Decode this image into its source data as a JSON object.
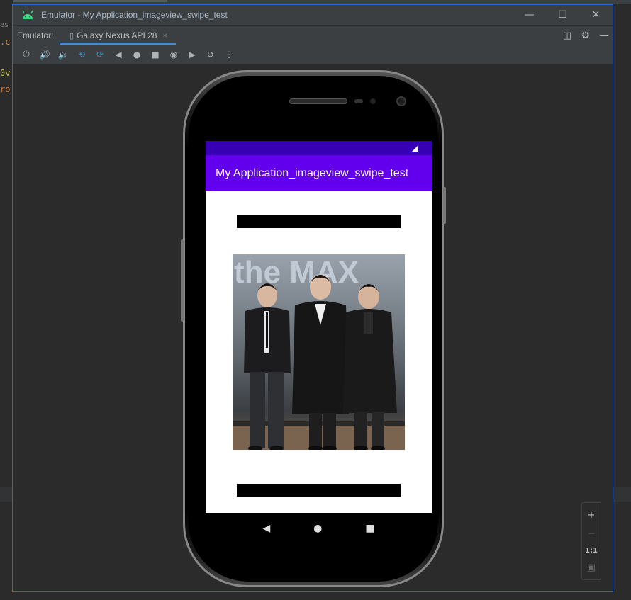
{
  "window": {
    "title": "Emulator - My Application_imageview_swipe_test"
  },
  "tabbar": {
    "label": "Emulator:",
    "device_tab": "Galaxy Nexus API 28",
    "close": "×"
  },
  "ide_fragments": {
    "line1": "es",
    "line2": ".c",
    "line3": "0v",
    "line4": "ro"
  },
  "app": {
    "title": "My Application_imageview_swipe_test"
  },
  "photo": {
    "caption_text": "the MAX"
  },
  "zoom": {
    "zoom_in": "+",
    "zoom_out": "−",
    "actual_size": "1:1"
  },
  "colors": {
    "status_bar": "#3700b3",
    "app_bar": "#6200ee",
    "window_border": "#2f65ca",
    "tab_underline": "#4a88c7"
  }
}
